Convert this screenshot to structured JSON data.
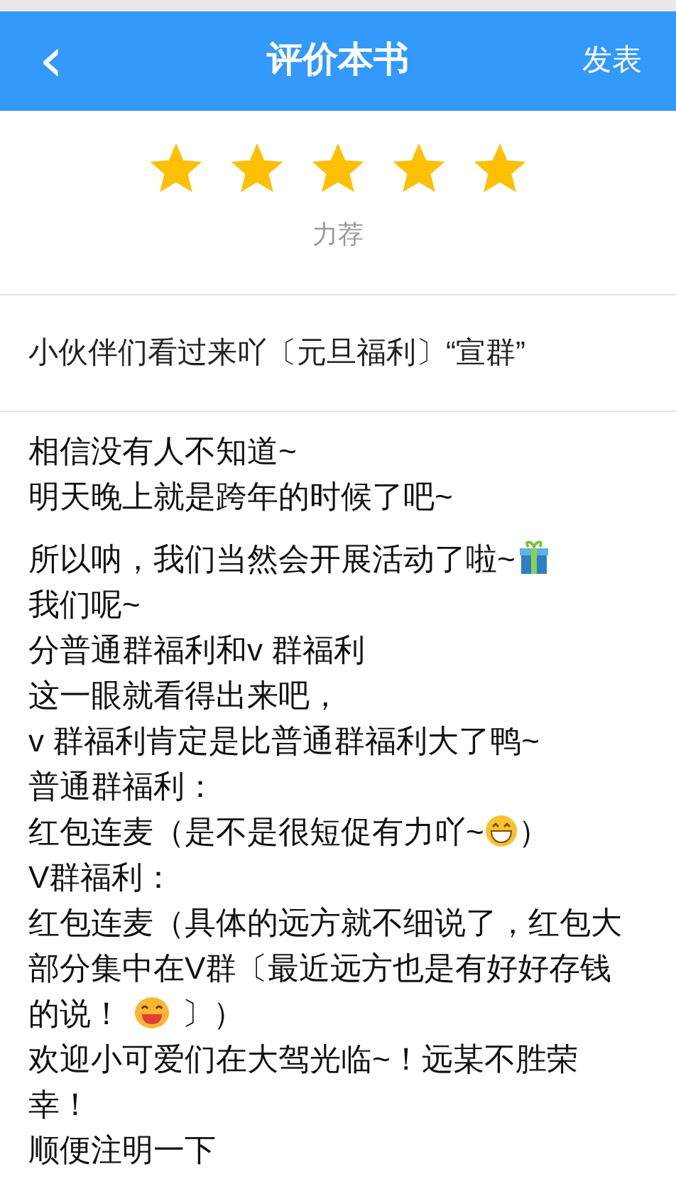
{
  "header": {
    "back_icon": "‹",
    "title": "评价本书",
    "action": "发表"
  },
  "rating": {
    "stars": 5,
    "label": "力荐"
  },
  "review_title": "小伙伴们看过来吖〔元旦福利〕“宣群”",
  "paragraphs": [
    {
      "lines": [
        [
          {
            "kind": "text",
            "text": "相信没有人不知道~"
          }
        ],
        [
          {
            "kind": "text",
            "text": "明天晚上就是跨年的时候了吧~"
          }
        ]
      ]
    },
    {
      "lines": [
        [
          {
            "kind": "text",
            "text": "所以呐，我们当然会开展活动了啦~"
          },
          {
            "kind": "gift"
          }
        ],
        [
          {
            "kind": "text",
            "text": "我们呢~"
          }
        ],
        [
          {
            "kind": "text",
            "text": "分普通群福利和v 群福利"
          }
        ],
        [
          {
            "kind": "text",
            "text": "这一眼就看得出来吧，"
          }
        ],
        [
          {
            "kind": "text",
            "text": "v 群福利肯定是比普通群福利大了鸭~"
          }
        ],
        [
          {
            "kind": "text",
            "text": "普通群福利："
          }
        ],
        [
          {
            "kind": "text",
            "text": "红包连麦（是不是很短促有力吖~"
          },
          {
            "kind": "laugh"
          },
          {
            "kind": "text",
            "text": "）"
          }
        ],
        [
          {
            "kind": "text",
            "text": "V群福利："
          }
        ],
        [
          {
            "kind": "text",
            "text": "红包连麦（具体的远方就不细说了，红包大"
          }
        ],
        [
          {
            "kind": "text",
            "text": "部分集中在V群〔最近远方也是有好好存钱"
          }
        ],
        [
          {
            "kind": "text",
            "text": "的说！"
          },
          {
            "kind": "smile"
          },
          {
            "kind": "text",
            "text": "〕）"
          }
        ],
        [
          {
            "kind": "text",
            "text": "欢迎小可爱们在大驾光临~！远某不胜荣"
          }
        ],
        [
          {
            "kind": "text",
            "text": "幸！"
          }
        ],
        [
          {
            "kind": "text",
            "text": "顺便注明一下"
          }
        ]
      ]
    }
  ]
}
